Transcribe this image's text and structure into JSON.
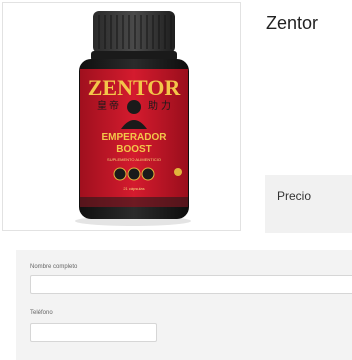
{
  "product": {
    "title": "Zentor",
    "image": {
      "brand": "ZENTOR",
      "line1": "EMPERADOR",
      "line2": "BOOST",
      "subtitle": "SUPLEMENTO ALIMENTICIO",
      "count": "21 cápsulas",
      "accent_color": "#c8162a",
      "gold_color": "#e2b43c"
    }
  },
  "price": {
    "label": "Precio"
  },
  "form": {
    "name_label": "Nombre completo",
    "name_value": "",
    "phone_label": "Teléfono",
    "phone_value": ""
  }
}
